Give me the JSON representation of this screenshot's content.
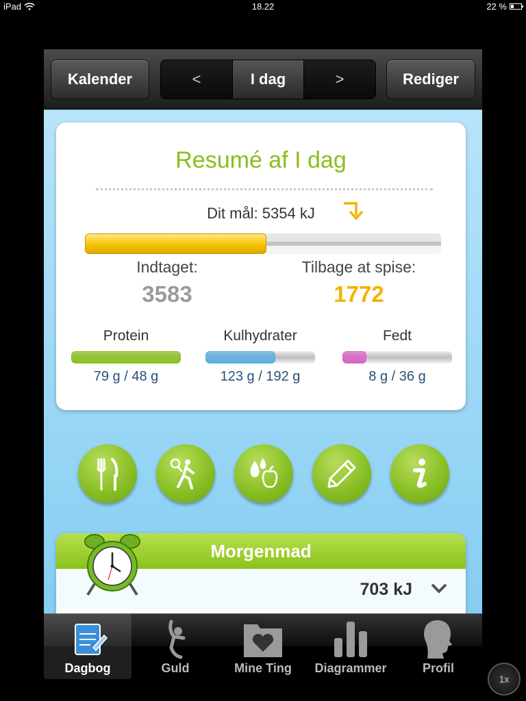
{
  "status": {
    "device": "iPad",
    "time": "18.22",
    "battery": "22 %"
  },
  "nav": {
    "left_button": "Kalender",
    "prev": "<",
    "current": "I dag",
    "next": ">",
    "right_button": "Rediger"
  },
  "summary": {
    "title": "Resumé af I dag",
    "goal_text": "Dit mål: 5354 kJ",
    "progress_fraction": 0.51,
    "eaten_label": "Indtaget:",
    "eaten_value": "3583",
    "remaining_label": "Tilbage at spise:",
    "remaining_value": "1772",
    "macros": [
      {
        "name": "Protein",
        "amount": "79 g / 48 g",
        "fraction": 1.0,
        "color": "#8cc21b"
      },
      {
        "name": "Kulhydrater",
        "amount": "123 g / 192 g",
        "fraction": 0.64,
        "color": "#5aaee0"
      },
      {
        "name": "Fedt",
        "amount": "8 g / 36 g",
        "fraction": 0.22,
        "color": "#d862c4"
      }
    ]
  },
  "actions": [
    "fork-knife-icon",
    "exercise-icon",
    "water-apple-icon",
    "pencil-icon",
    "info-icon"
  ],
  "meal": {
    "title": "Morgenmad",
    "energy": "703 kJ"
  },
  "tabs": [
    {
      "label": "Dagbog",
      "icon": "notepad-icon",
      "active": true
    },
    {
      "label": "Guld",
      "icon": "gold-figure-icon",
      "active": false
    },
    {
      "label": "Mine Ting",
      "icon": "heart-folder-icon",
      "active": false
    },
    {
      "label": "Diagrammer",
      "icon": "bar-chart-icon",
      "active": false
    },
    {
      "label": "Profil",
      "icon": "profile-head-icon",
      "active": false
    }
  ],
  "zoom": "1x",
  "colors": {
    "accent_green": "#8cbd1c",
    "goal_yellow": "#f4b300",
    "eaten_gray": "#9b9b9b"
  }
}
